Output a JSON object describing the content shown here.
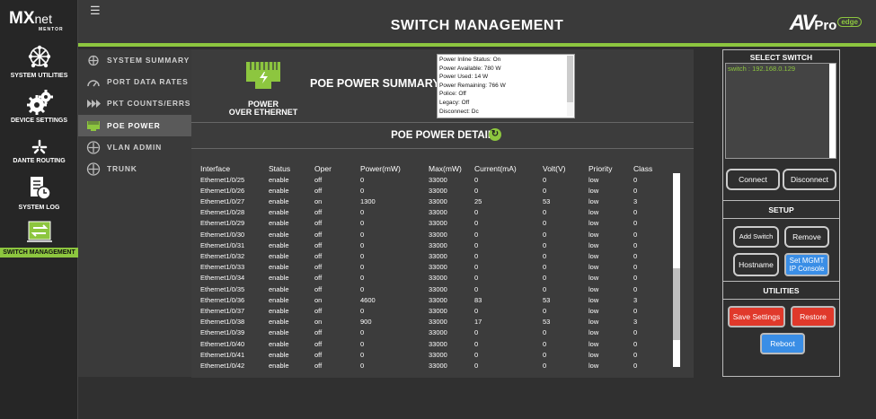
{
  "app": {
    "logo_main": "MX",
    "logo_net": "net",
    "logo_sub": "MENTOR",
    "page_title": "SWITCH MANAGEMENT",
    "brand_av": "AV",
    "brand_pro": "Pro",
    "brand_edge": "edge"
  },
  "colors": {
    "accent": "#8dc63f",
    "red": "#e0392b",
    "blue": "#3a8ee6"
  },
  "leftnav": [
    {
      "label": "SYSTEM UTILITIES",
      "icon": "network-globe-icon"
    },
    {
      "label": "DEVICE SETTINGS",
      "icon": "gears-icon"
    },
    {
      "label": "DANTE ROUTING",
      "icon": "dante-star-icon"
    },
    {
      "label": "SYSTEM LOG",
      "icon": "log-document-icon"
    },
    {
      "label": "SWITCH MANAGEMENT",
      "icon": "switch-arrows-icon",
      "active": true
    }
  ],
  "submenu": [
    {
      "label": "SYSTEM SUMMARY",
      "icon": "network-icon"
    },
    {
      "label": "PORT DATA RATES",
      "icon": "gauge-icon"
    },
    {
      "label": "PKT COUNTS/ERRS",
      "icon": "forward-arrows-icon"
    },
    {
      "label": "POE POWER",
      "icon": "poe-port-icon",
      "active": true
    },
    {
      "label": "VLAN ADMIN",
      "icon": "cross-arrows-icon"
    },
    {
      "label": "TRUNK",
      "icon": "cross-arrows-icon"
    }
  ],
  "poe": {
    "logo_caption_1": "POWER",
    "logo_caption_2": "OVER ETHERNET",
    "summary_title": "POE POWER SUMMARY:",
    "summary_lines": [
      "Power Inline Status: On",
      "Power Available: 780 W",
      "Power Used: 14 W",
      "Power Remaining: 766 W",
      "Police: Off",
      "Legacy: Off",
      "Disconnect: Dc"
    ],
    "detail_title": "POE POWER DETAIL",
    "columns": [
      "Interface",
      "Status",
      "Oper",
      "Power(mW)",
      "Max(mW)",
      "Current(mA)",
      "Volt(V)",
      "Priority",
      "Class"
    ],
    "rows": [
      [
        "Ethernet1/0/25",
        "enable",
        "off",
        "0",
        "33000",
        "0",
        "0",
        "low",
        "0"
      ],
      [
        "Ethernet1/0/26",
        "enable",
        "off",
        "0",
        "33000",
        "0",
        "0",
        "low",
        "0"
      ],
      [
        "Ethernet1/0/27",
        "enable",
        "on",
        "1300",
        "33000",
        "25",
        "53",
        "low",
        "3"
      ],
      [
        "Ethernet1/0/28",
        "enable",
        "off",
        "0",
        "33000",
        "0",
        "0",
        "low",
        "0"
      ],
      [
        "Ethernet1/0/29",
        "enable",
        "off",
        "0",
        "33000",
        "0",
        "0",
        "low",
        "0"
      ],
      [
        "Ethernet1/0/30",
        "enable",
        "off",
        "0",
        "33000",
        "0",
        "0",
        "low",
        "0"
      ],
      [
        "Ethernet1/0/31",
        "enable",
        "off",
        "0",
        "33000",
        "0",
        "0",
        "low",
        "0"
      ],
      [
        "Ethernet1/0/32",
        "enable",
        "off",
        "0",
        "33000",
        "0",
        "0",
        "low",
        "0"
      ],
      [
        "Ethernet1/0/33",
        "enable",
        "off",
        "0",
        "33000",
        "0",
        "0",
        "low",
        "0"
      ],
      [
        "Ethernet1/0/34",
        "enable",
        "off",
        "0",
        "33000",
        "0",
        "0",
        "low",
        "0"
      ],
      [
        "Ethernet1/0/35",
        "enable",
        "off",
        "0",
        "33000",
        "0",
        "0",
        "low",
        "0"
      ],
      [
        "Ethernet1/0/36",
        "enable",
        "on",
        "4600",
        "33000",
        "83",
        "53",
        "low",
        "3"
      ],
      [
        "Ethernet1/0/37",
        "enable",
        "off",
        "0",
        "33000",
        "0",
        "0",
        "low",
        "0"
      ],
      [
        "Ethernet1/0/38",
        "enable",
        "on",
        "900",
        "33000",
        "17",
        "53",
        "low",
        "3"
      ],
      [
        "Ethernet1/0/39",
        "enable",
        "off",
        "0",
        "33000",
        "0",
        "0",
        "low",
        "0"
      ],
      [
        "Ethernet1/0/40",
        "enable",
        "off",
        "0",
        "33000",
        "0",
        "0",
        "low",
        "0"
      ],
      [
        "Ethernet1/0/41",
        "enable",
        "off",
        "0",
        "33000",
        "0",
        "0",
        "low",
        "0"
      ],
      [
        "Ethernet1/0/42",
        "enable",
        "off",
        "0",
        "33000",
        "0",
        "0",
        "low",
        "0"
      ]
    ]
  },
  "right": {
    "select_title": "SELECT SWITCH",
    "switches": [
      "switch : 192.168.0.129"
    ],
    "connect": "Connect",
    "disconnect": "Disconnect",
    "setup_title": "SETUP",
    "add_switch": "Add Switch",
    "remove": "Remove",
    "hostname": "Hostname",
    "set_mgmt_1": "Set MGMT",
    "set_mgmt_2": "IP Console",
    "utilities_title": "UTILITIES",
    "save_settings": "Save Settings",
    "restore": "Restore",
    "reboot": "Reboot"
  }
}
